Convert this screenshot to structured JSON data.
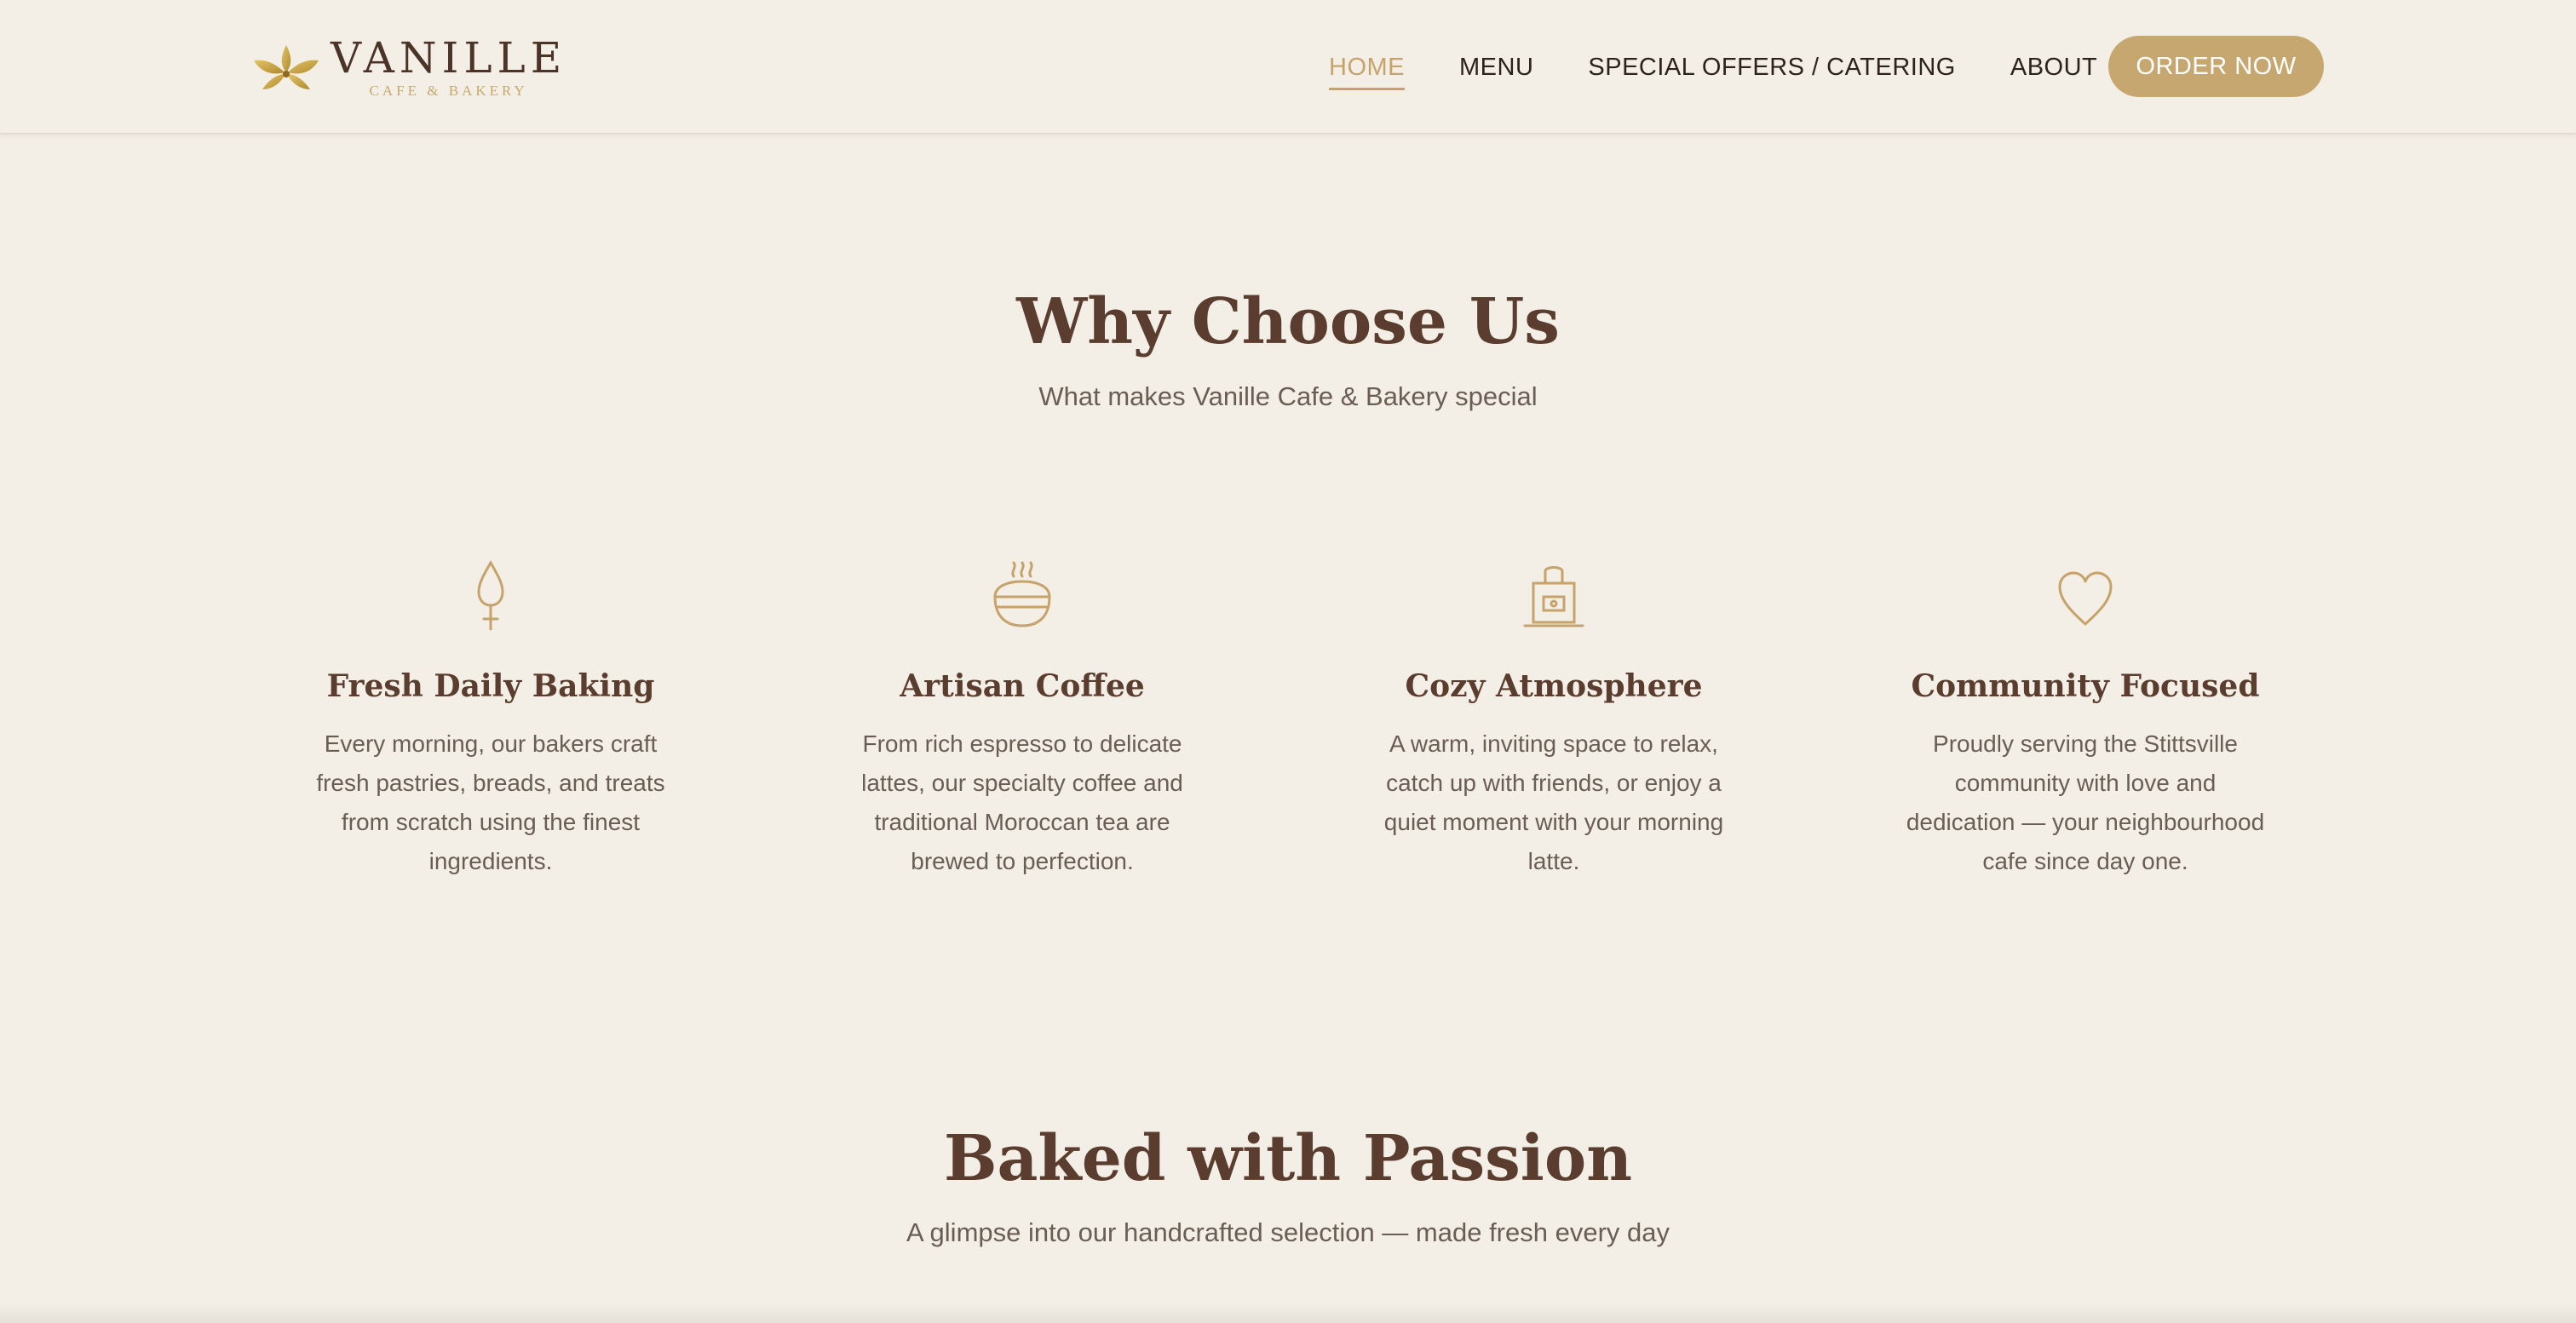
{
  "brand": {
    "name": "VANILLE",
    "tagline": "CAFE & BAKERY",
    "logo_icon": "vanilla-flower-icon"
  },
  "nav": {
    "items": [
      {
        "label": "HOME",
        "active": true
      },
      {
        "label": "MENU",
        "active": false
      },
      {
        "label": "SPECIAL OFFERS / CATERING",
        "active": false
      },
      {
        "label": "ABOUT",
        "active": false
      }
    ],
    "cta_label": "ORDER NOW"
  },
  "why": {
    "title": "Why Choose Us",
    "subtitle": "What makes Vanille Cafe & Bakery special",
    "features": [
      {
        "icon": "wheat-drop-icon",
        "title": "Fresh Daily Baking",
        "description": "Every morning, our bakers craft fresh pastries, breads, and treats from scratch using the finest ingredients."
      },
      {
        "icon": "coffee-bowl-icon",
        "title": "Artisan Coffee",
        "description": "From rich espresso to delicate lattes, our specialty coffee and traditional Moroccan tea are brewed to perfection."
      },
      {
        "icon": "fireplace-icon",
        "title": "Cozy Atmosphere",
        "description": "A warm, inviting space to relax, catch up with friends, or enjoy a quiet moment with your morning latte."
      },
      {
        "icon": "heart-icon",
        "title": "Community Focused",
        "description": "Proudly serving the Stittsville community with love and dedication — your neighbourhood cafe since day one."
      }
    ]
  },
  "passion": {
    "title": "Baked with Passion",
    "subtitle": "A glimpse into our handcrafted selection — made fresh every day"
  },
  "colors": {
    "background": "#f4efe6",
    "accent_gold": "#c6a770",
    "heading_brown": "#5a3d2e",
    "body_text": "#6a5d54"
  }
}
